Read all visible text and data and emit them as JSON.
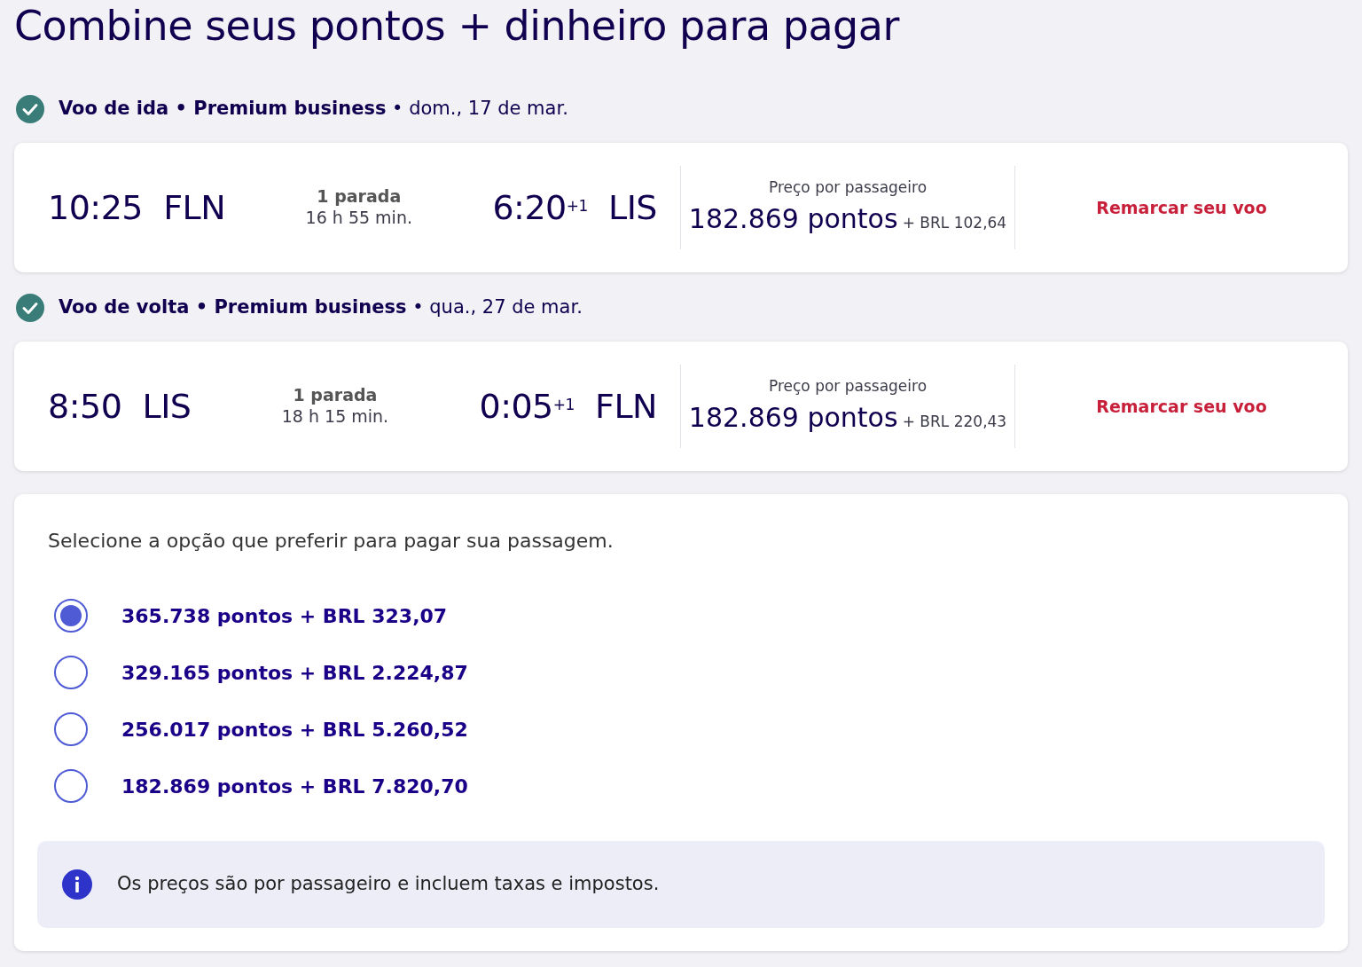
{
  "title": "Combine seus pontos + dinheiro para pagar",
  "segments": [
    {
      "confirmed": true,
      "heading": "**Voo de ida • Premium business** • dom., 17 de mar.",
      "depart_time": "10:25",
      "depart_airport": "FLN",
      "stops": "1 parada",
      "duration": "16 h 55 min.",
      "arrive_time": "6:20",
      "day_offset": "+1",
      "arrive_airport": "LIS",
      "price_label": "Preço por passageiro",
      "points": "182.869 pontos",
      "cash": "+ BRL 102,64",
      "action": "Remarcar seu voo"
    },
    {
      "confirmed": true,
      "heading": "**Voo de volta • Premium business** • qua., 27 de mar.",
      "depart_time": "8:50",
      "depart_airport": "LIS",
      "stops": "1 parada",
      "duration": "18 h 15 min.",
      "arrive_time": "0:05",
      "day_offset": "+1",
      "arrive_airport": "FLN",
      "price_label": "Preço por passageiro",
      "points": "182.869 pontos",
      "cash": "+ BRL 220,43",
      "action": "Remarcar seu voo"
    }
  ],
  "payment": {
    "prompt": "Selecione a opção que preferir para pagar sua passagem.",
    "options": [
      {
        "label": "365.738 pontos + BRL 323,07",
        "selected": true
      },
      {
        "label": "329.165 pontos + BRL 2.224,87",
        "selected": false
      },
      {
        "label": "256.017 pontos + BRL 5.260,52",
        "selected": false
      },
      {
        "label": "182.869 pontos + BRL 7.820,70",
        "selected": false
      }
    ],
    "note": "Os preços são por passageiro e incluem taxas e impostos."
  }
}
